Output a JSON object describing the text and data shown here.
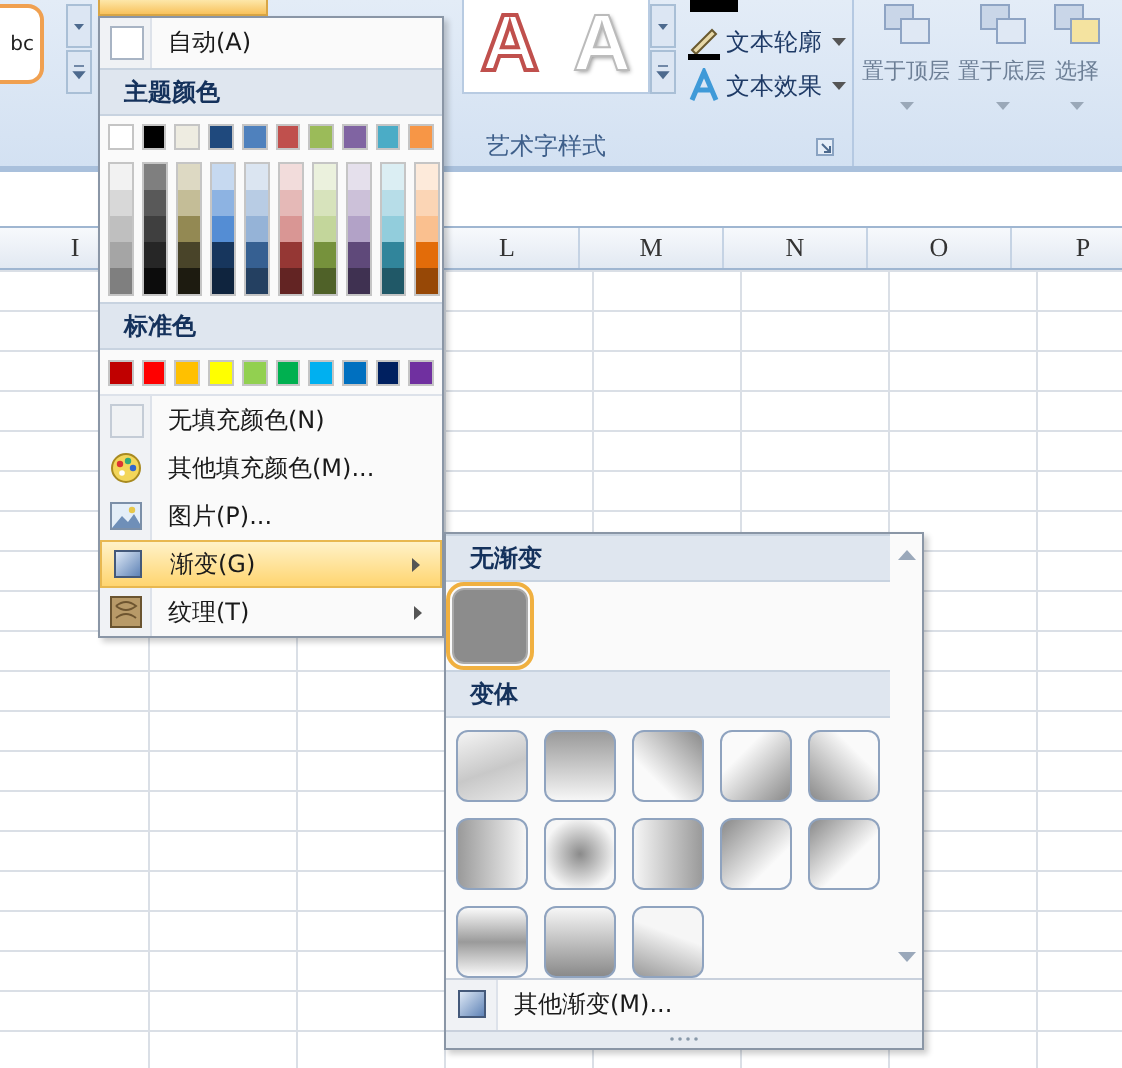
{
  "ribbon": {
    "style_sample": "bc",
    "wordart_samples": [
      "A",
      "A"
    ],
    "text_commands": [
      {
        "label": "文本轮廓"
      },
      {
        "label": "文本效果"
      }
    ],
    "group_label": "艺术字样式",
    "arrange_buttons": [
      {
        "label": "置于顶层"
      },
      {
        "label": "置于底层"
      },
      {
        "label": "选择"
      }
    ]
  },
  "columns": [
    "I",
    "L",
    "M",
    "N",
    "O",
    "P"
  ],
  "fill_menu": {
    "automatic": "自动(A)",
    "theme_header": "主题颜色",
    "theme_colors": [
      {
        "color": "#ffffff",
        "shades": [
          {
            "color": "#f2f2f2"
          },
          {
            "color": "#d8d8d8"
          },
          {
            "color": "#bfbfbf"
          },
          {
            "color": "#a5a5a5"
          },
          {
            "color": "#7f7f7f"
          }
        ]
      },
      {
        "color": "#000000",
        "shades": [
          {
            "color": "#7f7f7f"
          },
          {
            "color": "#595959"
          },
          {
            "color": "#3f3f3f"
          },
          {
            "color": "#262626"
          },
          {
            "color": "#0c0c0c"
          }
        ]
      },
      {
        "color": "#eeece1",
        "shades": [
          {
            "color": "#ddd9c3"
          },
          {
            "color": "#c4bd97"
          },
          {
            "color": "#938953"
          },
          {
            "color": "#494429"
          },
          {
            "color": "#1d1b10"
          }
        ]
      },
      {
        "color": "#1f497d",
        "shades": [
          {
            "color": "#c6d9f0"
          },
          {
            "color": "#8db3e2"
          },
          {
            "color": "#548dd4"
          },
          {
            "color": "#17365d"
          },
          {
            "color": "#0f243e"
          }
        ]
      },
      {
        "color": "#4f81bd",
        "shades": [
          {
            "color": "#dbe5f1"
          },
          {
            "color": "#b8cce4"
          },
          {
            "color": "#95b3d7"
          },
          {
            "color": "#366092"
          },
          {
            "color": "#244061"
          }
        ]
      },
      {
        "color": "#c0504d",
        "shades": [
          {
            "color": "#f2dcdb"
          },
          {
            "color": "#e5b9b7"
          },
          {
            "color": "#d99694"
          },
          {
            "color": "#953734"
          },
          {
            "color": "#632423"
          }
        ]
      },
      {
        "color": "#9bbb59",
        "shades": [
          {
            "color": "#ebf1dd"
          },
          {
            "color": "#d7e3bc"
          },
          {
            "color": "#c3d69b"
          },
          {
            "color": "#76923c"
          },
          {
            "color": "#4f6128"
          }
        ]
      },
      {
        "color": "#8064a2",
        "shades": [
          {
            "color": "#e5e0ec"
          },
          {
            "color": "#ccc1d9"
          },
          {
            "color": "#b2a2c7"
          },
          {
            "color": "#5f497a"
          },
          {
            "color": "#3f3151"
          }
        ]
      },
      {
        "color": "#4bacc6",
        "shades": [
          {
            "color": "#dbeef3"
          },
          {
            "color": "#b7dde8"
          },
          {
            "color": "#92cddc"
          },
          {
            "color": "#31859b"
          },
          {
            "color": "#205867"
          }
        ]
      },
      {
        "color": "#f79646",
        "shades": [
          {
            "color": "#fdeada"
          },
          {
            "color": "#fbd5b5"
          },
          {
            "color": "#fac08f"
          },
          {
            "color": "#e36c09"
          },
          {
            "color": "#974806"
          }
        ]
      }
    ],
    "standard_header": "标准色",
    "standard_colors": [
      {
        "color": "#c00000"
      },
      {
        "color": "#ff0000"
      },
      {
        "color": "#ffc000"
      },
      {
        "color": "#ffff00"
      },
      {
        "color": "#92d050"
      },
      {
        "color": "#00b050"
      },
      {
        "color": "#00b0f0"
      },
      {
        "color": "#0070c0"
      },
      {
        "color": "#002060"
      },
      {
        "color": "#7030a0"
      }
    ],
    "items": [
      {
        "label": "无填充颜色(N)",
        "submenu": false,
        "selected": false
      },
      {
        "label": "其他填充颜色(M)...",
        "submenu": false,
        "selected": false
      },
      {
        "label": "图片(P)...",
        "submenu": false,
        "selected": false
      },
      {
        "label": "渐变(G)",
        "submenu": true,
        "selected": true
      },
      {
        "label": "纹理(T)",
        "submenu": true,
        "selected": false
      }
    ]
  },
  "gradient_menu": {
    "none_header": "无渐变",
    "none_swatch": {
      "selected": true
    },
    "variants_header": "变体",
    "variants": [
      {
        "selected": false
      },
      {
        "selected": false
      },
      {
        "selected": false
      },
      {
        "selected": false
      },
      {
        "selected": false
      },
      {
        "selected": false
      },
      {
        "selected": false
      },
      {
        "selected": false
      },
      {
        "selected": false
      },
      {
        "selected": false
      },
      {
        "selected": false
      },
      {
        "selected": false
      },
      {
        "selected": false
      }
    ],
    "more": "其他渐变(M)..."
  }
}
